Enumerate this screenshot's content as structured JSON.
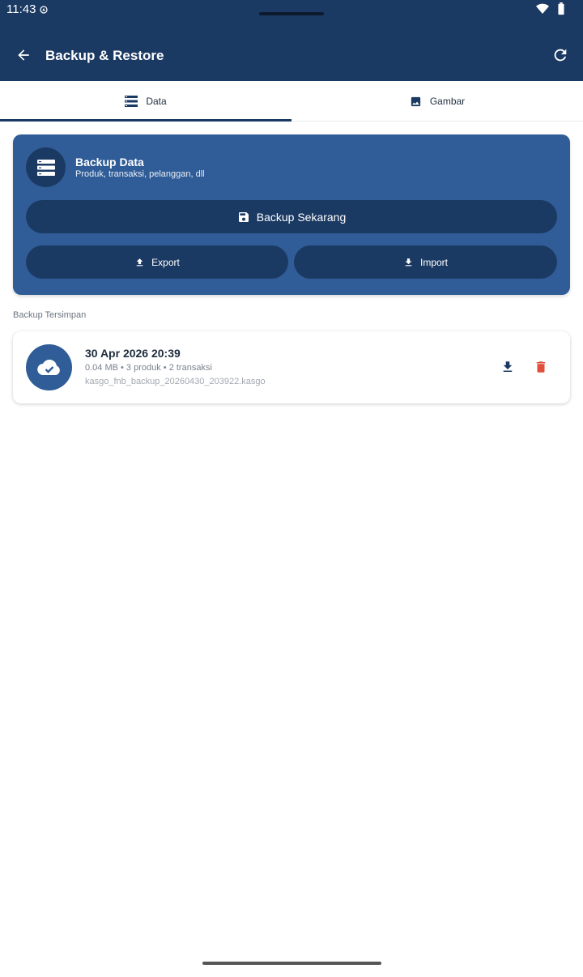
{
  "status": {
    "time": "11:43"
  },
  "appbar": {
    "title": "Backup & Restore"
  },
  "tabs": [
    {
      "label": "Data",
      "icon": "list-icon",
      "active": true
    },
    {
      "label": "Gambar",
      "icon": "image-icon",
      "active": false
    }
  ],
  "backup_card": {
    "title": "Backup Data",
    "subtitle": "Produk, transaksi, pelanggan, dll",
    "backup_now_label": "Backup Sekarang",
    "export_label": "Export",
    "import_label": "Import"
  },
  "saved_section": {
    "label": "Backup Tersimpan",
    "items": [
      {
        "date": "30 Apr 2026 20:39",
        "meta": "0.04 MB • 3 produk • 2 transaksi",
        "filename": "kasgo_fnb_backup_20260430_203922.kasgo"
      }
    ]
  },
  "colors": {
    "primary": "#1b3a63",
    "card": "#305d97",
    "delete": "#e04f3c"
  }
}
